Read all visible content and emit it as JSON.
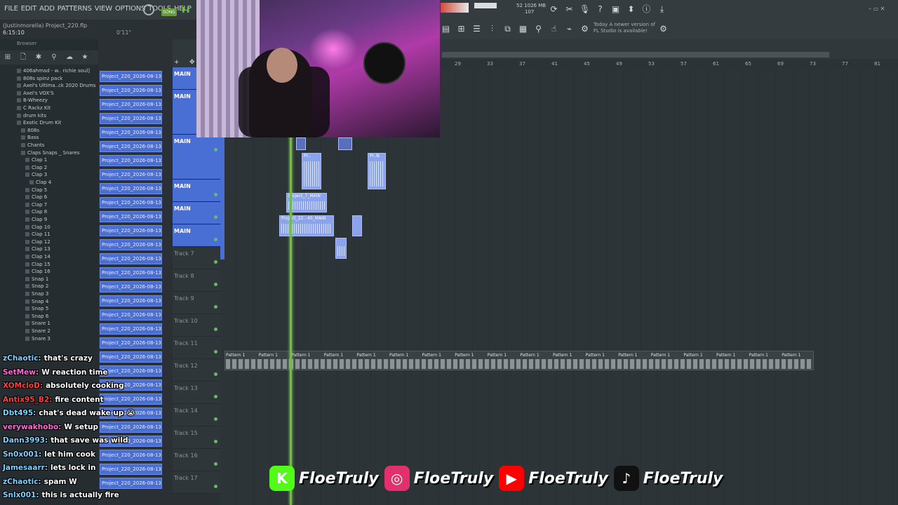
{
  "menu": {
    "items": [
      "FILE",
      "EDIT",
      "ADD",
      "PATTERNS",
      "VIEW",
      "OPTIONS",
      "TOOLS",
      "HELP"
    ],
    "song_label": "SONG"
  },
  "project": {
    "owner": "(Justinmorella)",
    "file": "Project_220.flp",
    "time": "6:15:10",
    "duration": "0'11\""
  },
  "toolbar": {
    "mem": "52",
    "mem2": "1026 MB",
    "mem3": "107",
    "hint_line1": "Today  A newer version of",
    "hint_line2": "FL Studio is available!"
  },
  "browser": {
    "header": "Browser",
    "items": [
      {
        "label": "406ahmad - w.. richie soul]",
        "indent": 1
      },
      {
        "label": "808s spinz pack",
        "indent": 1
      },
      {
        "label": "Axel's Ultima..ck 2020 Drums",
        "indent": 1
      },
      {
        "label": "Axel's VOX'S",
        "indent": 1
      },
      {
        "label": "B-Wheezy",
        "indent": 1
      },
      {
        "label": "C Rackz Kit",
        "indent": 1
      },
      {
        "label": "drum kits",
        "indent": 1
      },
      {
        "label": "Exotic Drum Kit",
        "indent": 1
      },
      {
        "label": "808s",
        "indent": 2
      },
      {
        "label": "Bass",
        "indent": 2
      },
      {
        "label": "Chants",
        "indent": 2
      },
      {
        "label": "Claps Snaps _ Snares",
        "indent": 2
      },
      {
        "label": "Clap 1",
        "indent": 3
      },
      {
        "label": "Clap 2",
        "indent": 3
      },
      {
        "label": "Clap 3",
        "indent": 3
      },
      {
        "label": "Clap 4",
        "indent": 4
      },
      {
        "label": "Clap 5",
        "indent": 3
      },
      {
        "label": "Clap 6",
        "indent": 3
      },
      {
        "label": "Clap 7",
        "indent": 3
      },
      {
        "label": "Clap 8",
        "indent": 3
      },
      {
        "label": "Clap 9",
        "indent": 3
      },
      {
        "label": "Clap 10",
        "indent": 3
      },
      {
        "label": "Clap 11",
        "indent": 3
      },
      {
        "label": "Clap 12",
        "indent": 3
      },
      {
        "label": "Clap 13",
        "indent": 3
      },
      {
        "label": "Clap 14",
        "indent": 3
      },
      {
        "label": "Clap 15",
        "indent": 3
      },
      {
        "label": "Clap 16",
        "indent": 3
      },
      {
        "label": "Snap 1",
        "indent": 3
      },
      {
        "label": "Snap 2",
        "indent": 3
      },
      {
        "label": "Snap 3",
        "indent": 3
      },
      {
        "label": "Snap 4",
        "indent": 3
      },
      {
        "label": "Snap 5",
        "indent": 3
      },
      {
        "label": "Snap 6",
        "indent": 3
      },
      {
        "label": "Snare 1",
        "indent": 3
      },
      {
        "label": "Snare 2",
        "indent": 3
      },
      {
        "label": "Snare 3",
        "indent": 3
      }
    ]
  },
  "playlist_clip": "Project_220_2026-08-13...",
  "ruler": [
    "29",
    "33",
    "37",
    "41",
    "45",
    "49",
    "53",
    "57",
    "61",
    "65",
    "69",
    "73",
    "77",
    "81"
  ],
  "tracks": [
    {
      "name": "MAIN",
      "main": true
    },
    {
      "name": "MAIN",
      "main": true
    },
    {
      "name": "MAIN",
      "main": true
    },
    {
      "name": "MAIN",
      "main": true
    },
    {
      "name": "MAIN",
      "main": true
    },
    {
      "name": "MAIN",
      "main": true
    },
    {
      "name": "Track 7",
      "main": false
    },
    {
      "name": "Track 8",
      "main": false
    },
    {
      "name": "Track 9",
      "main": false
    },
    {
      "name": "Track 10",
      "main": false
    },
    {
      "name": "Track 11",
      "main": false
    },
    {
      "name": "Track 12",
      "main": false
    },
    {
      "name": "Track 13",
      "main": false
    },
    {
      "name": "Track 14",
      "main": false
    },
    {
      "name": "Track 15",
      "main": false
    },
    {
      "name": "Track 16",
      "main": false
    },
    {
      "name": "Track 17",
      "main": false
    }
  ],
  "clips": {
    "c1": "Pr..",
    "c2": "Pr..N",
    "c3": "Project_7_MAIN",
    "c4": "Project_22..-45_MAIN",
    "c5": "",
    "c6": ""
  },
  "pattern_label": "Pattern 1",
  "chat": [
    {
      "user": "zChaotic:",
      "msg": "that's crazy",
      "color": "#7fd0ff"
    },
    {
      "user": "SetMew:",
      "msg": "W reaction time",
      "color": "#ff6ad5"
    },
    {
      "user": "XOMcloD:",
      "msg": "absolutely cooking",
      "color": "#ff4040"
    },
    {
      "user": "Antix95_B2:",
      "msg": "fire content",
      "color": "#ff4040"
    },
    {
      "user": "Dbt495:",
      "msg": "chat's dead wake up 😭",
      "color": "#7fd0ff"
    },
    {
      "user": "verywakhobo:",
      "msg": "W setup",
      "color": "#ff6ad5"
    },
    {
      "user": "Dann3993:",
      "msg": "that save was wild",
      "color": "#7fd0ff"
    },
    {
      "user": "Sn0x001:",
      "msg": "let him cook",
      "color": "#7fd0ff"
    },
    {
      "user": "Jamesaarr:",
      "msg": "lets lock in",
      "color": "#7fd0ff"
    },
    {
      "user": "zChaotic:",
      "msg": "spam W",
      "color": "#7fd0ff"
    },
    {
      "user": "Snlx001:",
      "msg": "this is actually fire",
      "color": "#7fd0ff"
    }
  ],
  "socials": [
    {
      "platform": "kick",
      "handle": "FloeTruly",
      "color": "#53fc18"
    },
    {
      "platform": "instagram",
      "handle": "FloeTruly",
      "color": "#e1306c"
    },
    {
      "platform": "youtube",
      "handle": "FloeTruly",
      "color": "#ff0000"
    },
    {
      "platform": "tiktok",
      "handle": "FloeTruly",
      "color": "#111111"
    }
  ]
}
